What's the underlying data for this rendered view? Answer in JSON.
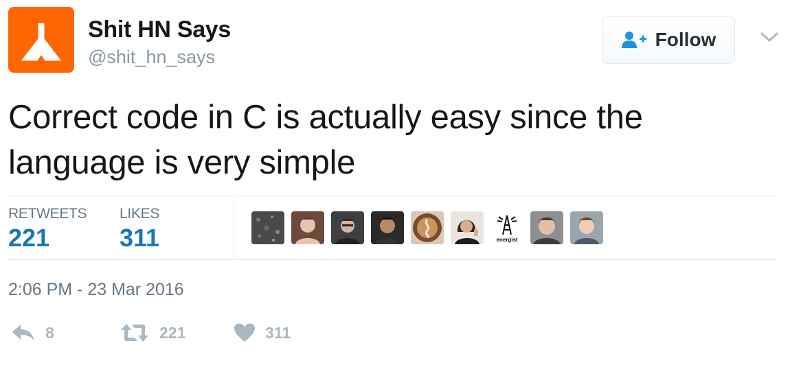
{
  "user": {
    "name": "Shit HN Says",
    "handle": "@shit_hn_says",
    "avatar_color": "#ff6600"
  },
  "follow_button": {
    "label": "Follow",
    "icon": "add-user-icon"
  },
  "tweet": {
    "line1": "Correct code in C is actually easy since the",
    "line2": "language is very simple",
    "timestamp": "2:06 PM - 23 Mar 2016"
  },
  "stats": {
    "retweets_label": "RETWEETS",
    "retweets_value": "221",
    "likes_label": "LIKES",
    "likes_value": "311"
  },
  "likers": [
    {
      "icon": "avatar-texture"
    },
    {
      "icon": "avatar-person"
    },
    {
      "icon": "avatar-person"
    },
    {
      "icon": "avatar-person"
    },
    {
      "icon": "avatar-coffee"
    },
    {
      "icon": "avatar-person"
    },
    {
      "icon": "avatar-energist",
      "label": "energist"
    },
    {
      "icon": "avatar-person"
    },
    {
      "icon": "avatar-person"
    }
  ],
  "actions": {
    "reply_count": "8",
    "retweet_count": "221",
    "like_count": "311"
  },
  "colors": {
    "link_blue": "#1b95e0",
    "muted": "#657786",
    "icon_gray": "#aab8c2",
    "border": "#e1e8ed"
  }
}
